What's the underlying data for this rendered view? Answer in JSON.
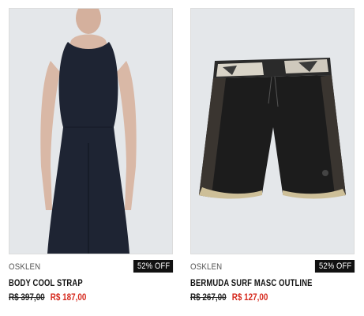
{
  "products": [
    {
      "brand": "OSKLEN",
      "discount": "52% OFF",
      "name": "BODY COOL STRAP",
      "old_price": "R$ 397,00",
      "new_price": "R$ 187,00",
      "image": "navy-sleeveless-jumpsuit"
    },
    {
      "brand": "OSKLEN",
      "discount": "52% OFF",
      "name": "BERMUDA SURF MASC OUTLINE",
      "old_price": "R$ 267,00",
      "new_price": "R$ 127,00",
      "image": "black-surf-boardshorts"
    }
  ],
  "colors": {
    "badge": "#111111",
    "sale_price": "#d62a1e"
  }
}
